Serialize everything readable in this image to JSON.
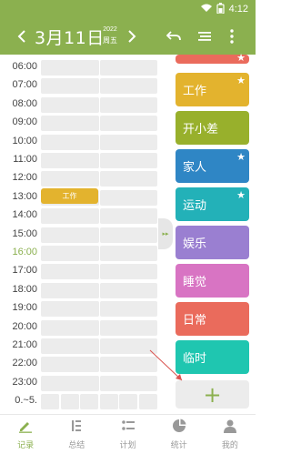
{
  "status_bar": {
    "time": "4:12",
    "wifi_icon": "wifi-icon",
    "battery_icon": "battery-icon"
  },
  "header": {
    "date": "3月11日",
    "year": "2022",
    "weekday": "周五",
    "prev_icon": "chevron-left-icon",
    "next_icon": "chevron-right-icon",
    "undo_icon": "undo-icon",
    "list_icon": "list-icon",
    "more_icon": "more-vertical-icon"
  },
  "timeline": {
    "hours": [
      "06:00",
      "07:00",
      "08:00",
      "09:00",
      "10:00",
      "11:00",
      "12:00",
      "13:00",
      "14:00",
      "15:00",
      "16:00",
      "17:00",
      "18:00",
      "19:00",
      "20:00",
      "21:00",
      "22:00",
      "23:00",
      "0.~5."
    ],
    "current_hour": "16:00",
    "events": [
      {
        "label": "工作",
        "hour": "13:00",
        "color": "#e3b32e"
      }
    ]
  },
  "categories": [
    {
      "label": "工作",
      "color": "#e3b32e",
      "starred": true
    },
    {
      "label": "开小差",
      "color": "#98b02c",
      "starred": false
    },
    {
      "label": "家人",
      "color": "#2f86c5",
      "starred": true
    },
    {
      "label": "运动",
      "color": "#23b1b8",
      "starred": true
    },
    {
      "label": "娱乐",
      "color": "#9a7fd1",
      "starred": false
    },
    {
      "label": "睡觉",
      "color": "#d874c3",
      "starred": false
    },
    {
      "label": "日常",
      "color": "#ea6b5c",
      "starred": false
    },
    {
      "label": "临时",
      "color": "#1fc6b0",
      "starred": false
    }
  ],
  "add_button": {
    "label": "+"
  },
  "bottom_nav": [
    {
      "label": "记录",
      "icon": "pencil-icon",
      "active": true
    },
    {
      "label": "总结",
      "icon": "summary-icon",
      "active": false
    },
    {
      "label": "计划",
      "icon": "plan-list-icon",
      "active": false
    },
    {
      "label": "统计",
      "icon": "pie-chart-icon",
      "active": false
    },
    {
      "label": "我的",
      "icon": "person-icon",
      "active": false
    }
  ],
  "colors": {
    "accent": "#8bb04f",
    "cell": "#ececec"
  }
}
